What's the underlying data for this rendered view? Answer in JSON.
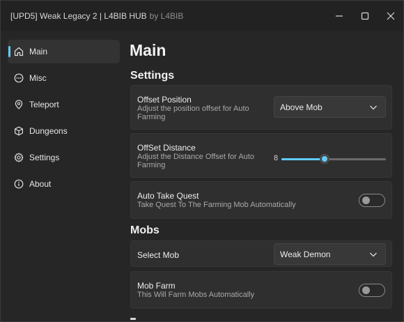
{
  "window": {
    "title": "[UPD5] Weak Legacy 2 | L4BIB HUB",
    "subtitle": "by L4BIB",
    "controls": [
      "minimize",
      "maximize",
      "close"
    ]
  },
  "sidebar": {
    "items": [
      {
        "label": "Main",
        "icon": "home-icon",
        "active": true
      },
      {
        "label": "Misc",
        "icon": "ellipsis-circle-icon",
        "active": false
      },
      {
        "label": "Teleport",
        "icon": "map-pin-icon",
        "active": false
      },
      {
        "label": "Dungeons",
        "icon": "cube-icon",
        "active": false
      },
      {
        "label": "Settings",
        "icon": "gear-icon",
        "active": false
      },
      {
        "label": "About",
        "icon": "info-icon",
        "active": false
      }
    ]
  },
  "main": {
    "title": "Main",
    "sections": {
      "settings": {
        "title": "Settings",
        "offset_position": {
          "title": "Offset Position",
          "description": "Adjust the position offset for Auto Farming",
          "value": "Above Mob"
        },
        "offset_distance": {
          "title": "OffSet Distance",
          "description": "Adjust the Distance Offset for Auto Farming",
          "value": "8",
          "fraction": 0.41
        },
        "auto_take_quest": {
          "title": "Auto Take Quest",
          "description": "Take Quest To The Farming Mob Automatically",
          "enabled": false
        }
      },
      "mobs": {
        "title": "Mobs",
        "select_mob": {
          "title": "Select Mob",
          "value": "Weak Demon"
        },
        "mob_farm": {
          "title": "Mob Farm",
          "description": "This Will Farm Mobs Automatically",
          "enabled": false
        }
      }
    }
  },
  "colors": {
    "accent": "#60cdff",
    "background": "#262626",
    "card": "#2f2f2f"
  }
}
